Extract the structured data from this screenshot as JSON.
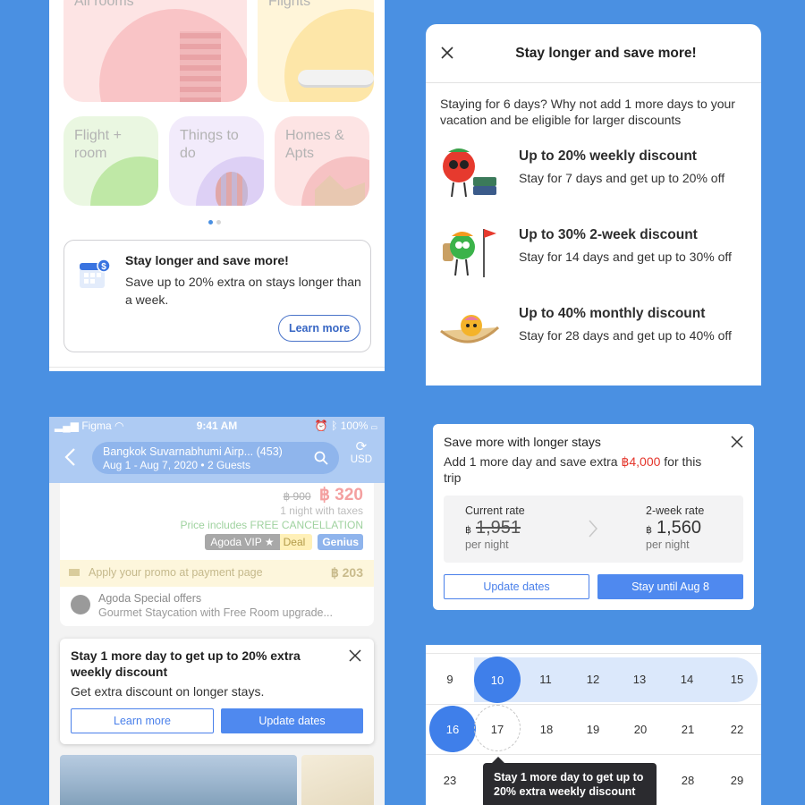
{
  "home": {
    "tiles": {
      "all_rooms": "All rooms",
      "flights": "Flights",
      "flight_room": "Flight + room",
      "things_to_do": "Things to do",
      "homes_apts": "Homes & Apts"
    },
    "promo": {
      "title": "Stay longer and save more!",
      "desc": "Save up to 20% extra on stays longer than a week.",
      "button": "Learn more"
    }
  },
  "modal": {
    "title": "Stay longer and save more!",
    "intro": "Staying for 6 days? Why not add 1 more days to your vacation and be eligible for larger discounts",
    "offers": [
      {
        "title": "Up to 20% weekly discount",
        "desc": "Stay for 7 days and get up to 20% off"
      },
      {
        "title": "Up to 30% 2-week discount",
        "desc": "Stay for 14 days and get up to 30% off"
      },
      {
        "title": "Up to 40% monthly discount",
        "desc": "Stay for 28 days and get up to 40% off"
      }
    ]
  },
  "phone": {
    "status": {
      "carrier": "Figma",
      "time": "9:41 AM",
      "battery": "100%"
    },
    "search": {
      "location": "Bangkok Suvarnabhumi Airp... (453)",
      "details": "Aug 1 - Aug 7, 2020 • 2 Guests",
      "currency": "USD"
    },
    "listing": {
      "old_price": "฿ 900",
      "currency_symbol": "฿",
      "price": "320",
      "price_note": "1 night with taxes",
      "cancellation": "Price includes FREE CANCELLATION",
      "badge_agoda": "Agoda VIP",
      "badge_deal": "Deal",
      "badge_genius": "Genius",
      "promo_text": "Apply your promo at payment page",
      "promo_value": "฿ 203",
      "special_title": "Agoda Special offers",
      "special_desc": "Gourmet Staycation with Free Room upgrade..."
    },
    "sheet": {
      "title": "Stay 1 more day to get up to 20% extra weekly discount",
      "desc": "Get extra discount on longer stays.",
      "learn_more": "Learn more",
      "update_dates": "Update dates"
    }
  },
  "save_card": {
    "title": "Save more with longer stays",
    "desc_prefix": "Add 1 more day and save extra ",
    "desc_amount": "฿4,000",
    "desc_suffix": " for this trip",
    "current": {
      "label": "Current rate",
      "currency": "฿",
      "value": "1,951",
      "unit": "per night"
    },
    "two_week": {
      "label": "2-week rate",
      "currency": "฿",
      "value": "1,560",
      "unit": "per night"
    },
    "update_dates": "Update dates",
    "stay_until": "Stay until Aug 8"
  },
  "calendar": {
    "row1": [
      "9",
      "10",
      "11",
      "12",
      "13",
      "14",
      "15"
    ],
    "row2": [
      "16",
      "17",
      "18",
      "19",
      "20",
      "21",
      "22"
    ],
    "row3": [
      "23",
      "",
      "",
      "",
      "",
      "28",
      "29"
    ],
    "tooltip": "Stay 1 more day to get up to 20% extra weekly discount"
  },
  "colors": {
    "background": "#4a90e2",
    "primary": "#4f89ef",
    "accent_red": "#e4352b"
  }
}
